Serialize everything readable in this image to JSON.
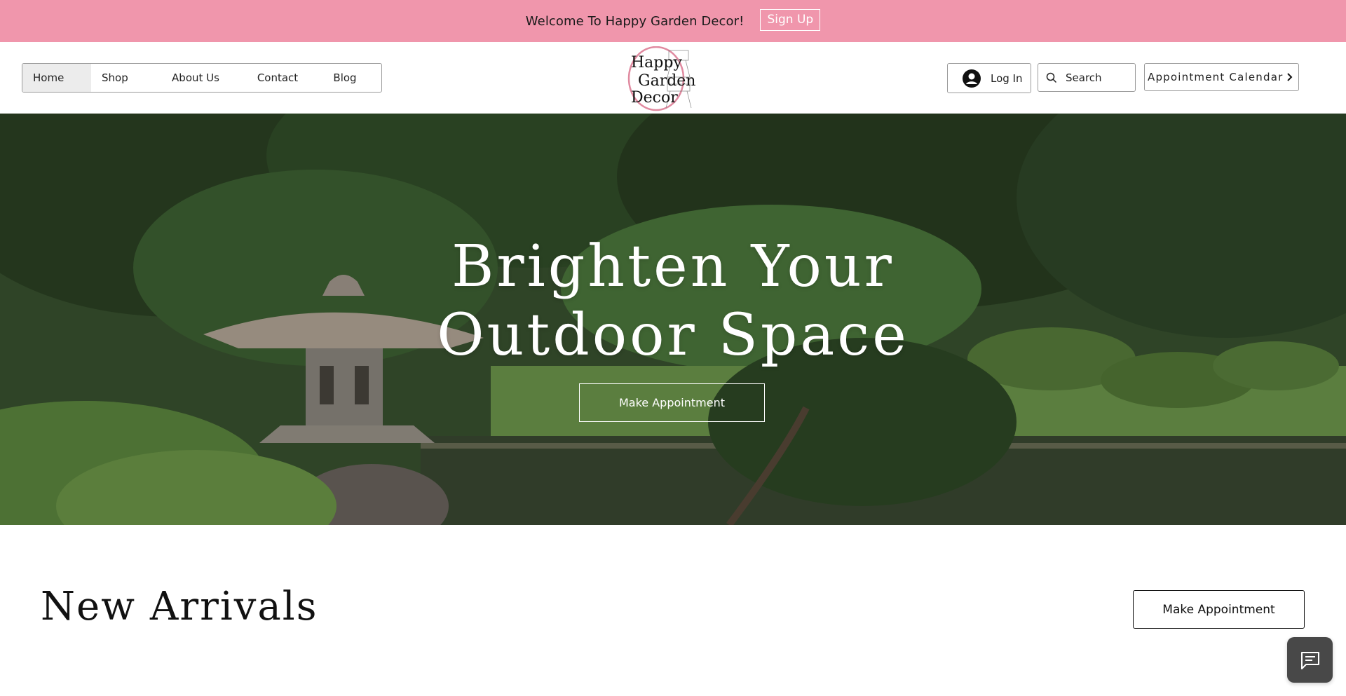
{
  "promo": {
    "text": "Welcome To Happy Garden Decor!",
    "signup_label": "Sign Up",
    "background": "#f096ac"
  },
  "nav": {
    "items": [
      {
        "label": "Home",
        "active": true
      },
      {
        "label": "Shop"
      },
      {
        "label": "About Us"
      },
      {
        "label": "Contact"
      },
      {
        "label": "Blog"
      }
    ]
  },
  "logo": {
    "lines": [
      "Happy",
      "Garden",
      "Decor"
    ]
  },
  "header": {
    "login_label": "Log In",
    "search_placeholder": "Search",
    "appointment_calendar_label": "Appointment Calendar"
  },
  "hero": {
    "title": "Brighten Your Outdoor Space",
    "button_label": "Make Appointment"
  },
  "new_arrivals": {
    "title": "New Arrivals",
    "button_label": "Make Appointment"
  },
  "icons": {
    "avatar": "user-avatar-icon",
    "search": "search-icon",
    "chevron": "chevron-right-icon",
    "chat": "chat-icon"
  }
}
